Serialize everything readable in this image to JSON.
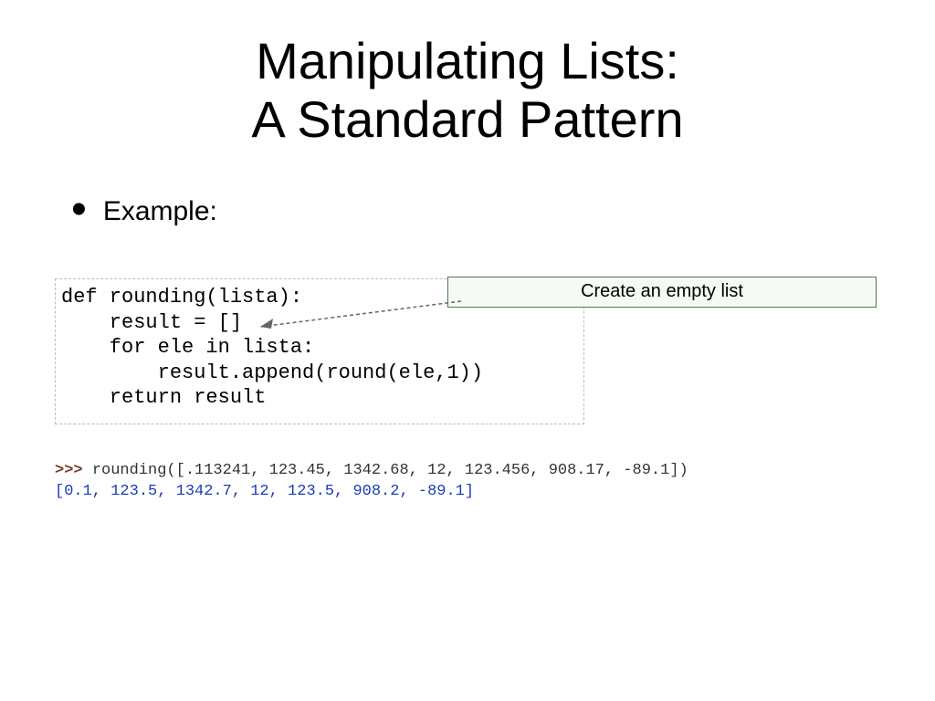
{
  "title_line1": "Manipulating Lists:",
  "title_line2": "A Standard Pattern",
  "bullet_label": "Example:",
  "code": {
    "l1": "def rounding(lista):",
    "l2": "    result = []",
    "l3": "    for ele in lista:",
    "l4": "        result.append(round(ele,1))",
    "l5": "    return result"
  },
  "callout": "Create an empty list",
  "terminal": {
    "prompt": ">>> ",
    "call": "rounding([.113241, 123.45, 1342.68, 12, 123.456, 908.17, -89.1])",
    "result": "[0.1, 123.5, 1342.7, 12, 123.5, 908.2, -89.1]"
  }
}
